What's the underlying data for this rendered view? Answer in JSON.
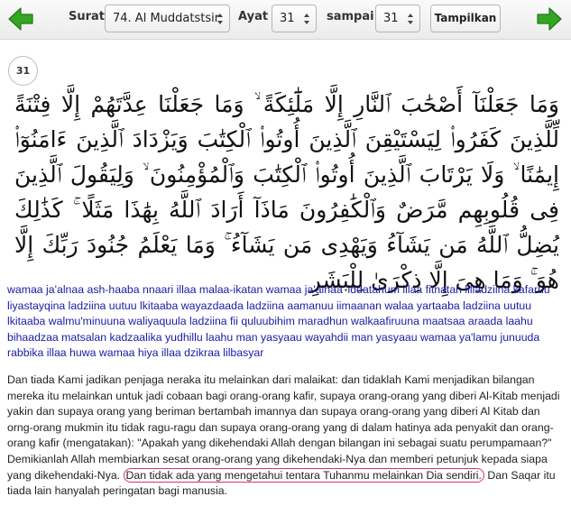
{
  "toolbar": {
    "prev_icon": "arrow-left-icon",
    "next_icon": "arrow-right-icon",
    "surat_label": "Surat",
    "surat_value": "74. Al Muddatstsir",
    "ayat_label": "Ayat",
    "ayat_value": "31",
    "sampai_label": "sampai",
    "sampai_value": "31",
    "submit_label": "Tampilkan",
    "accent_color": "#2e9e1f"
  },
  "verse": {
    "number": "31",
    "arabic": "وَمَا جَعَلْنَآ أَصْحَٰبَ ٱلنَّارِ إِلَّا مَلَٰٓئِكَةً ۙ وَمَا جَعَلْنَا عِدَّتَهُمْ إِلَّا فِتْنَةً لِّلَّذِينَ كَفَرُوا۟ لِيَسْتَيْقِنَ ٱلَّذِينَ أُوتُوا۟ ٱلْكِتَٰبَ وَيَزْدَادَ ٱلَّذِينَ ءَامَنُوٓا۟ إِيمَٰنًا ۙ وَلَا يَرْتَابَ ٱلَّذِينَ أُوتُوا۟ ٱلْكِتَٰبَ وَٱلْمُؤْمِنُونَ ۙ وَلِيَقُولَ ٱلَّذِينَ فِى قُلُوبِهِم مَّرَضٌ وَٱلْكَٰفِرُونَ مَاذَآ أَرَادَ ٱللَّهُ بِهَٰذَا مَثَلًا ۚ كَذَٰلِكَ يُضِلُّ ٱللَّهُ مَن يَشَآءُ وَيَهْدِى مَن يَشَآءُ ۚ وَمَا يَعْلَمُ جُنُودَ رَبِّكَ إِلَّا هُوَ ۚ وَمَا هِىَ إِلَّا ذِكْرَىٰ لِلْبَشَرِ",
    "transliteration": "wamaa ja'alnaa ash-haaba nnaari illaa malaa-ikatan wamaa ja'alnaa 'iddatahum illaa fitnatan lilladziina kafaruu liyastayqina ladziina uutuu lkitaaba wayazdaada ladziina aamanuu iimaanan walaa yartaaba ladziina uutuu lkitaaba walmu'minuuna waliyaquula ladziina fii quluubihim maradhun walkaafiruuna maatsaa araada laahu bihaadzaa matsalan kadzaalika yudhillu laahu man yasyaau wayahdii man yasyaau wamaa ya'lamu junuuda rabbika illaa huwa wamaa hiya illaa dzikraa lilbasyar",
    "translation_before": "Dan tiada Kami jadikan penjaga neraka itu melainkan dari malaikat: dan tidaklah Kami menjadikan bilangan mereka itu melainkan untuk jadi cobaan bagi orang-orang kafir, supaya orang-orang yang diberi Al-Kitab menjadi yakin dan supaya orang yang beriman bertambah imannya dan supaya orang-orang yang diberi Al Kitab dan orng-orang mukmin itu tidak ragu-ragu dan supaya orang-orang yang di dalam hatinya ada penyakit dan orang-orang kafir (mengatakan): \"Apakah yang dikehendaki Allah dengan bilangan ini sebagai suatu perumpamaan?\" Demikianlah Allah membiarkan sesat orang-orang yang dikehendaki-Nya dan memberi petunjuk kepada siapa yang dikehendaki-Nya.",
    "translation_highlight": "Dan tidak ada yang mengetahui tentara Tuhanmu melainkan Dia sendiri.",
    "translation_after": "Dan Saqar itu tiada lain hanyalah peringatan bagi manusia.",
    "highlight_color": "#d4317a"
  }
}
